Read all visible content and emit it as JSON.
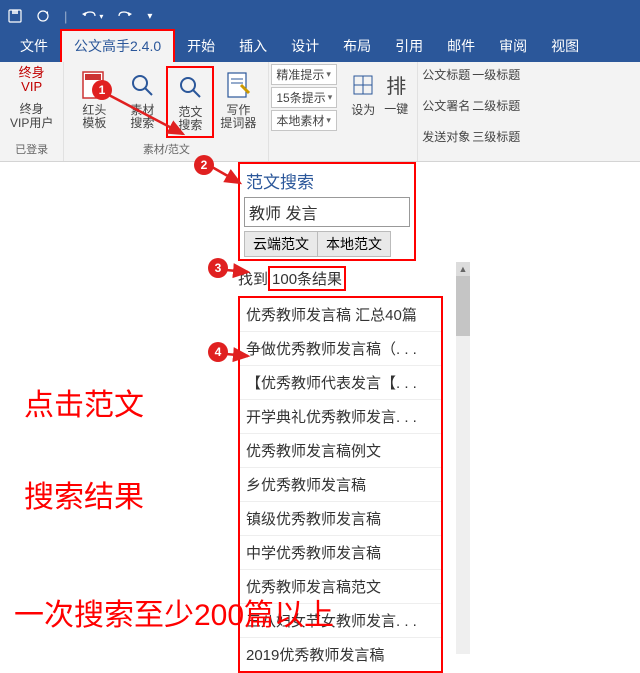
{
  "titlebar": {
    "save_icon": "save-icon",
    "undo_icon": "undo-icon",
    "redo_icon": "redo-icon"
  },
  "tabs": {
    "items": [
      {
        "label": "文件"
      },
      {
        "label": "公文高手2.4.0"
      },
      {
        "label": "开始"
      },
      {
        "label": "插入"
      },
      {
        "label": "设计"
      },
      {
        "label": "布局"
      },
      {
        "label": "引用"
      },
      {
        "label": "邮件"
      },
      {
        "label": "审阅"
      },
      {
        "label": "视图"
      }
    ],
    "active_index": 1
  },
  "ribbon": {
    "vip": {
      "top1": "终身",
      "top2": "VIP",
      "mid1": "终身",
      "mid2": "VIP用户"
    },
    "btn_hongtou": {
      "l1": "红头",
      "l2": "模板"
    },
    "btn_sucai": {
      "l1": "素材",
      "l2": "搜索"
    },
    "btn_fanwen": {
      "l1": "范文",
      "l2": "搜索"
    },
    "btn_xiezuo": {
      "l1": "写作",
      "l2": "提词器"
    },
    "dd1": "精准提示",
    "dd2": "15条提示",
    "dd3": "本地素材",
    "btn_sheji": "设为",
    "btn_paiban": "排",
    "btn_yijian": "一键",
    "cmds": [
      "公文标题",
      "一级标题",
      "公文署名",
      "二级标题",
      "发送对象",
      "三级标题"
    ],
    "group_label_left": "已登录",
    "group_label_mid": "素材/范文"
  },
  "pane": {
    "title": "范文搜索",
    "query": "教师 发言",
    "tab_cloud": "云端范文",
    "tab_local": "本地范文",
    "count_prefix": "找到",
    "count_val": "100条结果"
  },
  "results": [
    "优秀教师发言稿 汇总40篇",
    "争做优秀教师发言稿（. . .",
    "【优秀教师代表发言【. . .",
    "开学典礼优秀教师发言. . .",
    "优秀教师发言稿例文",
    "乡优秀教师发言稿",
    "镇级优秀教师发言稿",
    "中学优秀教师发言稿",
    "优秀教师发言稿范文",
    "三八妇女节女教师发言. . .",
    "2019优秀教师发言稿"
  ],
  "callouts": {
    "c1": "1",
    "c2": "2",
    "c3": "3",
    "c4": "4"
  },
  "annotations": {
    "line1": "点击范文",
    "line2": "搜索结果",
    "line3": "一次搜索至少200篇以上"
  },
  "chart_data": null
}
